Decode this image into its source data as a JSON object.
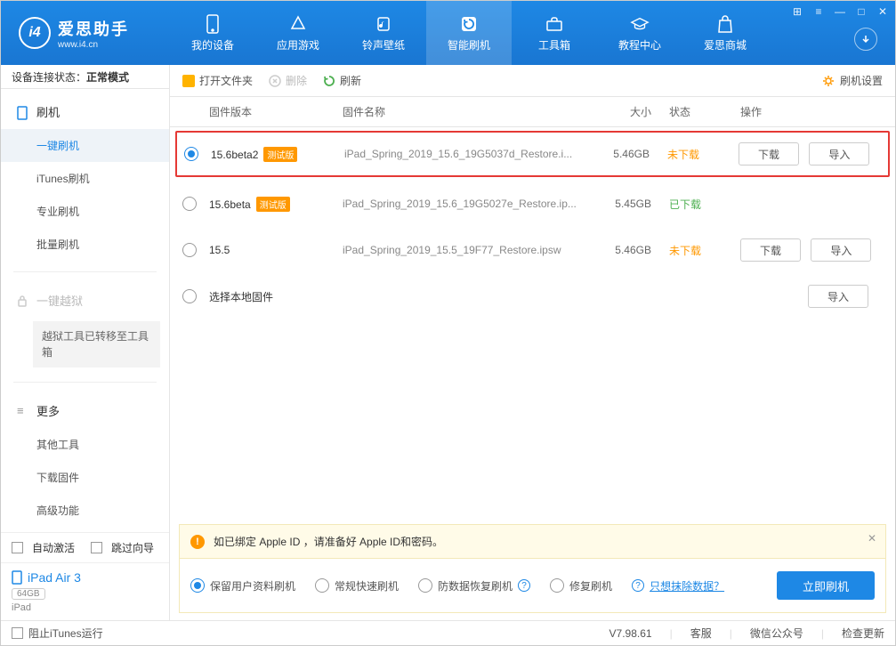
{
  "app": {
    "title": "爱思助手",
    "subtitle": "www.i4.cn"
  },
  "nav": {
    "items": [
      {
        "label": "我的设备"
      },
      {
        "label": "应用游戏"
      },
      {
        "label": "铃声壁纸"
      },
      {
        "label": "智能刷机"
      },
      {
        "label": "工具箱"
      },
      {
        "label": "教程中心"
      },
      {
        "label": "爱思商城"
      }
    ]
  },
  "sidebar": {
    "conn_prefix": "设备连接状态：",
    "conn_mode": "正常模式",
    "flash_head": "刷机",
    "items": [
      "一键刷机",
      "iTunes刷机",
      "专业刷机",
      "批量刷机"
    ],
    "jailbreak_head": "一键越狱",
    "jailbreak_note": "越狱工具已转移至工具箱",
    "more_head": "更多",
    "more_items": [
      "其他工具",
      "下载固件",
      "高级功能"
    ],
    "auto_activate": "自动激活",
    "skip_guide": "跳过向导",
    "device": {
      "name": "iPad Air 3",
      "capacity": "64GB",
      "type": "iPad"
    }
  },
  "toolbar": {
    "open_folder": "打开文件夹",
    "delete": "删除",
    "refresh": "刷新",
    "settings": "刷机设置"
  },
  "table": {
    "headers": {
      "version": "固件版本",
      "name": "固件名称",
      "size": "大小",
      "status": "状态",
      "action": "操作"
    },
    "badge_test": "测试版",
    "select_local": "选择本地固件",
    "btn_download": "下载",
    "btn_import": "导入",
    "rows": [
      {
        "version": "15.6beta2",
        "test": true,
        "name": "iPad_Spring_2019_15.6_19G5037d_Restore.i...",
        "size": "5.46GB",
        "status": "未下载",
        "st_class": "orange",
        "selected": true,
        "actions": true,
        "highlight": true
      },
      {
        "version": "15.6beta",
        "test": true,
        "name": "iPad_Spring_2019_15.6_19G5027e_Restore.ip...",
        "size": "5.45GB",
        "status": "已下载",
        "st_class": "green",
        "selected": false,
        "actions": false
      },
      {
        "version": "15.5",
        "test": false,
        "name": "iPad_Spring_2019_15.5_19F77_Restore.ipsw",
        "size": "5.46GB",
        "status": "未下载",
        "st_class": "orange",
        "selected": false,
        "actions": true
      }
    ]
  },
  "alert": {
    "text": "如已绑定 Apple ID ，请准备好 Apple ID和密码。"
  },
  "options": {
    "keep_data": "保留用户资料刷机",
    "normal": "常规快速刷机",
    "anti": "防数据恢复刷机",
    "repair": "修复刷机",
    "erase_link": "只想抹除数据？",
    "flash_now": "立即刷机"
  },
  "statusbar": {
    "block_itunes": "阻止iTunes运行",
    "version": "V7.98.61",
    "support": "客服",
    "wechat": "微信公众号",
    "check_update": "检查更新"
  }
}
